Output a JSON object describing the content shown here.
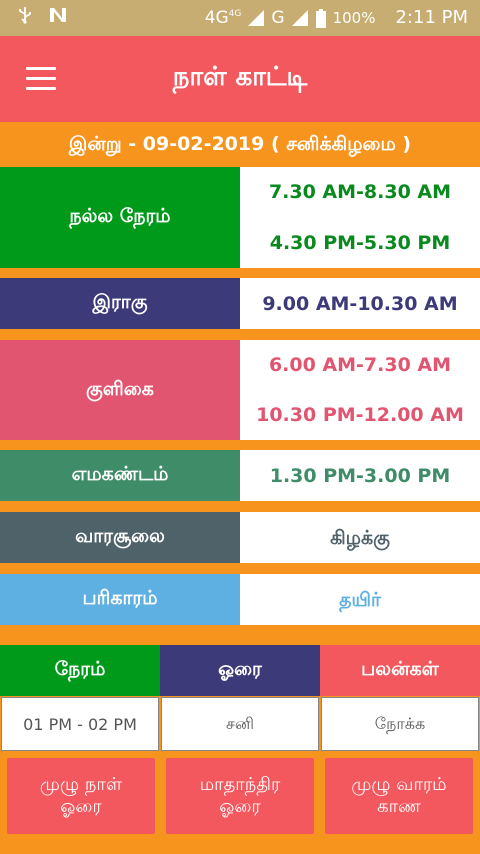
{
  "status_bar": {
    "network": "4G",
    "network_small": "4G",
    "carrier_g": "G",
    "battery": "100%",
    "time": "2:11 PM",
    "icons": [
      "usb-icon",
      "n-notification-icon",
      "signal-icon",
      "battery-icon"
    ]
  },
  "app_bar": {
    "title": "நாள் காட்டி",
    "menu_icon": "hamburger-menu-icon"
  },
  "today_line": "இன்று - 09-02-2019 ( சனிக்கிழமை )",
  "rows": [
    {
      "label": "நல்ல நேரம்",
      "values": [
        "7.30 AM-8.30 AM",
        "4.30 PM-5.30 PM"
      ],
      "label_color": "#009a1a",
      "value_color": "#0a8a1e"
    },
    {
      "label": "இராகு",
      "values": [
        "9.00 AM-10.30 AM"
      ],
      "label_color": "#3c3a78",
      "value_color": "#3c3a78"
    },
    {
      "label": "குளிகை",
      "values": [
        "6.00 AM-7.30 AM",
        "10.30 PM-12.00 AM"
      ],
      "label_color": "#e25571",
      "value_color": "#e25571"
    },
    {
      "label": "எமகண்டம்",
      "values": [
        "1.30 PM-3.00 PM"
      ],
      "label_color": "#3f8c68",
      "value_color": "#3f8c68"
    },
    {
      "label": "வாரசூலை",
      "values": [
        "கிழக்கு"
      ],
      "label_color": "#506269",
      "value_color": "#506269"
    },
    {
      "label": "பரிகாரம்",
      "values": [
        "தயிர்"
      ],
      "label_color": "#5fb0e2",
      "value_color": "#5fb0e2"
    }
  ],
  "hora_table": {
    "headers": [
      "நேரம்",
      "ஓரை",
      "பலன்கள்"
    ],
    "header_colors": [
      "#009a1a",
      "#3c3a78",
      "#f4585f"
    ],
    "cells": [
      "01 PM - 02 PM",
      "சனி",
      "நோக்க"
    ]
  },
  "buttons": [
    {
      "line1": "முழு நாள்",
      "line2": "ஓரை"
    },
    {
      "line1": "மாதாந்திர",
      "line2": "ஓரை"
    },
    {
      "line1": "முழு வாரம்",
      "line2": "காண"
    }
  ],
  "colors": {
    "background": "#f7941d",
    "app_bar": "#f4585f",
    "status_bar": "#c8ad73"
  }
}
